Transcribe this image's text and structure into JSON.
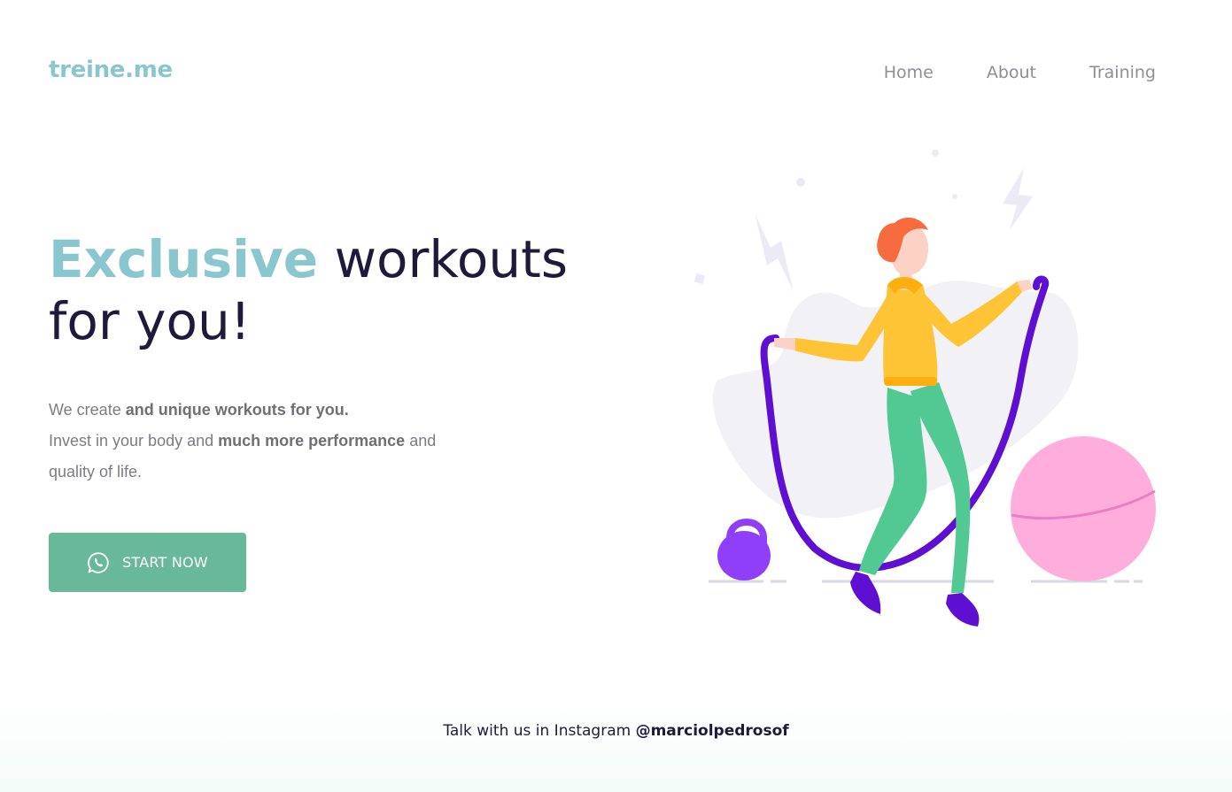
{
  "header": {
    "logo": "treine.me",
    "nav": [
      {
        "label": "Home"
      },
      {
        "label": "About"
      },
      {
        "label": "Training"
      }
    ]
  },
  "hero": {
    "headline_accent": "Exclusive",
    "headline_rest_line1": " workouts",
    "headline_line2": "for you!",
    "description": {
      "line1_plain": "We create ",
      "line1_bold": "and unique workouts for you.",
      "line2_plain_a": "Invest in your body and ",
      "line2_bold": "much more performance",
      "line2_plain_b": " and quality of life."
    },
    "cta_label": "START NOW",
    "cta_icon": "whatsapp-icon"
  },
  "illustration": {
    "subject": "woman-jumping-rope-illustration",
    "colors": {
      "rope": "#5f0fd1",
      "top": "#ffc436",
      "pants": "#52c992",
      "ball": "#ffaedb",
      "kettlebell": "#8f3ffa",
      "blob": "#f1f1f6"
    }
  },
  "footer": {
    "text": "Talk with us in Instagram ",
    "handle": "@marciolpedrosof"
  },
  "colors": {
    "accent": "#8ac6cd",
    "heading": "#1f1a3c",
    "button": "#67b99a",
    "muted_text": "#7c7c86"
  }
}
